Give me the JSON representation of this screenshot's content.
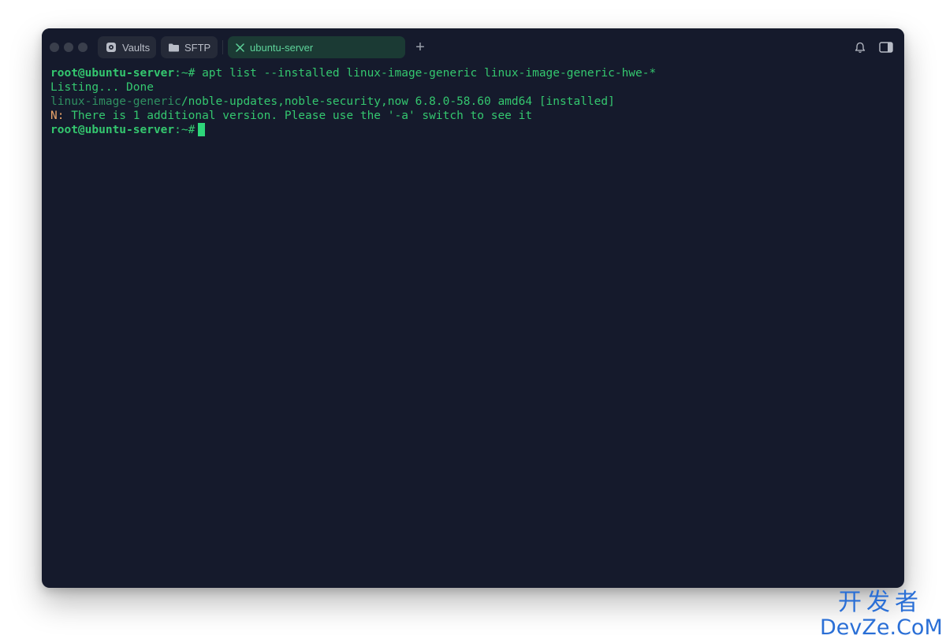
{
  "window": {
    "tabs": [
      {
        "label": "Vaults",
        "icon": "vault-icon"
      },
      {
        "label": "SFTP",
        "icon": "folder-icon"
      },
      {
        "label": "ubuntu-server",
        "icon": "close-icon",
        "active": true
      }
    ],
    "new_tab_label": "+",
    "right_icons": [
      "bell-icon",
      "sidebar-toggle-icon"
    ]
  },
  "terminal": {
    "line1": {
      "prompt": "root@ubuntu-server",
      "sep": ":~# ",
      "command": "apt list --installed linux-image-generic linux-image-generic-hwe-*"
    },
    "line2": {
      "text": "Listing... Done"
    },
    "line3": {
      "pkg": "linux-image-generic",
      "rest": "/noble-updates,noble-security,now 6.8.0-58.60 amd64 [installed]"
    },
    "line4": {
      "prefix": "N:",
      "text": " There is 1 additional version. Please use the '-a' switch to see it"
    },
    "line5": {
      "prompt": "root@ubuntu-server",
      "sep": ":~#"
    }
  },
  "watermark": {
    "cn": "开发者",
    "en": "DevZe.CoM"
  },
  "colors": {
    "background": "#151a2c",
    "accent": "#34c76f",
    "warning": "#e8a36a",
    "watermark": "#2a6fd6"
  }
}
